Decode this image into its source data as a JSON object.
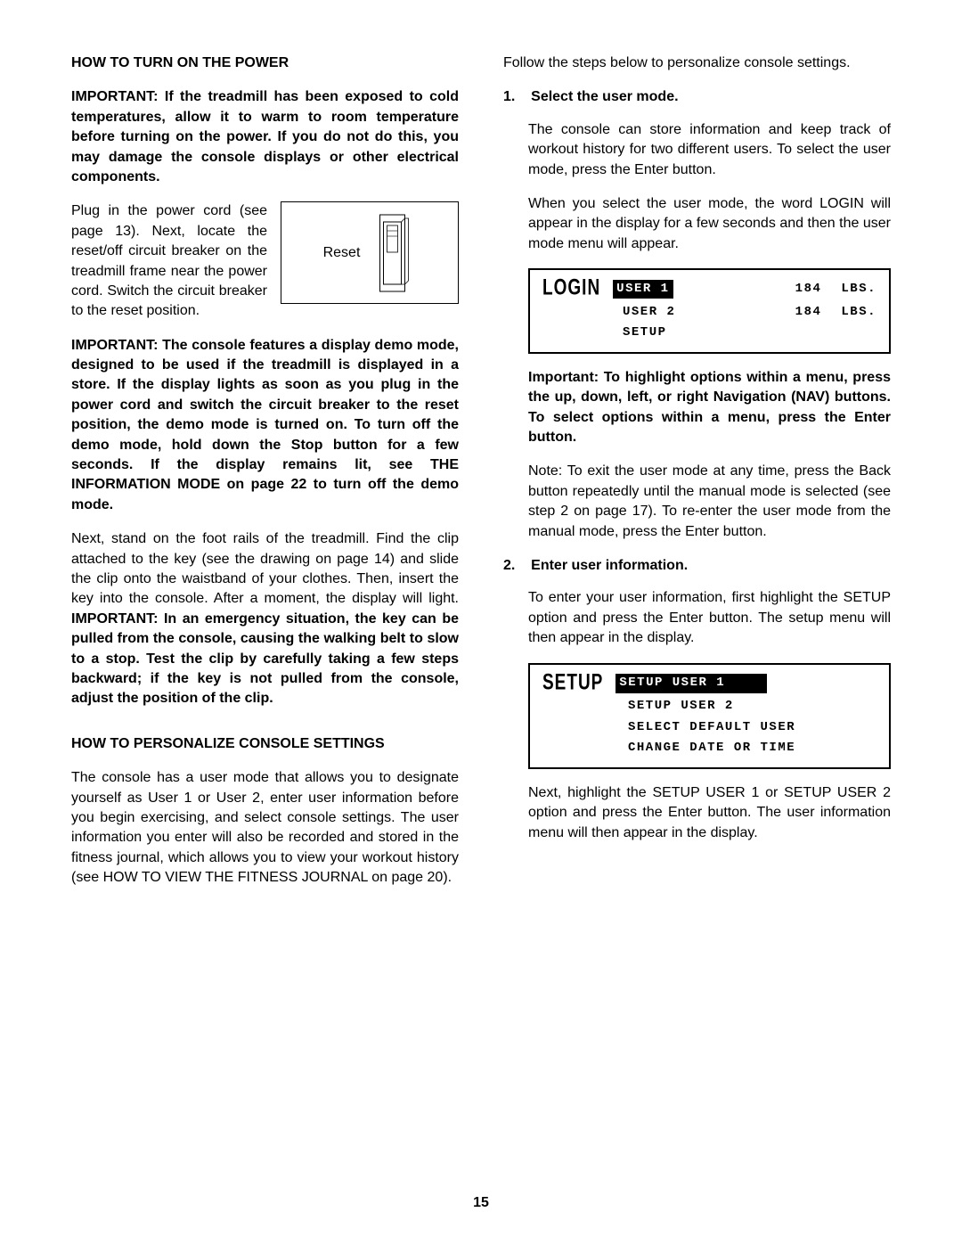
{
  "left": {
    "heading1": "HOW TO TURN ON THE POWER",
    "important1": "IMPORTANT: If the treadmill has been exposed to cold temperatures, allow it to warm to room temperature before turning on the power. If you do not do this, you may damage the console displays or other electrical components.",
    "plugText": "Plug in the power cord (see page 13). Next, locate the reset/off circuit breaker on the treadmill frame near the power cord. Switch the circuit breaker to the reset position.",
    "resetLabel": "Reset",
    "important2": "IMPORTANT: The console features a display demo mode, designed to be used if the treadmill is displayed in a store. If the display lights as soon as you plug in the power cord and switch the circuit breaker to the reset position, the demo mode is turned on. To turn off the demo mode, hold down the Stop button for a few seconds. If the display remains lit, see THE INFORMATION MODE on page 22 to turn off the demo mode.",
    "para3_part1": "Next, stand on the foot rails of the treadmill. Find the clip attached to the key (see the drawing on page 14) and slide the clip onto the waistband of your clothes. Then, insert the key into the console. After a moment, the display will light. ",
    "para3_part2_bold": "IMPORTANT: In an emergency situation, the key can be pulled from the console, causing the walking belt to slow to a stop. Test the clip by carefully taking a few steps backward; if the key is not pulled from the console, adjust the position of the clip.",
    "heading2": "HOW TO PERSONALIZE CONSOLE SETTINGS",
    "para4": "The console has a user mode that allows you to designate yourself as User 1 or User 2, enter user information before you begin exercising, and select console settings. The user information you enter will also be recorded and stored in the fitness journal, which allows you to view your workout history (see HOW TO VIEW THE FITNESS JOURNAL on page 20)."
  },
  "right": {
    "intro": "Follow the steps below to personalize console settings.",
    "step1": {
      "num": "1.",
      "title": "Select the user mode.",
      "p1": "The console can store information and keep track of workout history for two different users. To select the user mode, press the Enter button.",
      "p2": "When you select the user mode, the word LOGIN will appear in the display for a few seconds and then the user mode menu will appear.",
      "display": {
        "label": "LOGIN",
        "rows": [
          {
            "name": "USER 1",
            "selected": true,
            "weight": "184",
            "unit": "LBS."
          },
          {
            "name": "USER 2",
            "selected": false,
            "weight": "184",
            "unit": "LBS."
          },
          {
            "name": "SETUP",
            "selected": false
          }
        ]
      },
      "p3_bold": "Important: To highlight options within a menu, press the up, down, left, or right Navigation (NAV) buttons. To select options within a menu, press the Enter button.",
      "p4": "Note: To exit the user mode at any time, press the Back button repeatedly until the manual mode is selected (see step 2 on page 17). To re-enter the user mode from the manual mode, press the Enter button."
    },
    "step2": {
      "num": "2.",
      "title": "Enter user information.",
      "p1": "To enter your user information, first highlight the SETUP option and press the Enter button. The setup menu will then appear in the display.",
      "display": {
        "label": "SETUP",
        "rows": [
          {
            "name": "SETUP USER 1",
            "selected": true
          },
          {
            "name": "SETUP USER 2",
            "selected": false
          },
          {
            "name": "SELECT DEFAULT USER",
            "selected": false
          },
          {
            "name": "CHANGE DATE OR TIME",
            "selected": false
          }
        ]
      },
      "p2": "Next, highlight the SETUP USER 1 or SETUP USER 2 option and press the Enter button. The user information menu will then appear in the display."
    }
  },
  "pageNumber": "15"
}
